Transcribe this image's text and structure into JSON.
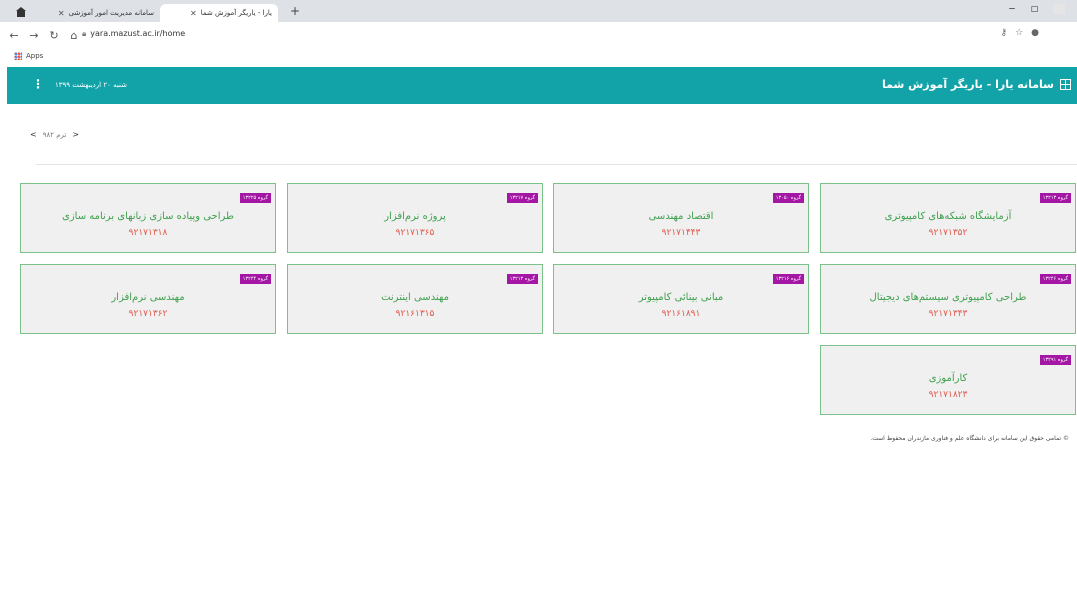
{
  "browser": {
    "tabs": [
      {
        "title": "سامانه مدیریت امور آموزشی"
      },
      {
        "title": "یارا - یاریگر آموزش شما"
      }
    ],
    "url": "yara.mazust.ac.ir/home",
    "bookmarks_apps": "Apps"
  },
  "header": {
    "brand": "سامانه یارا - یاریگر آموزش شما",
    "date": "شنبه ۲۰ اردیبهشت ۱۳۹۹"
  },
  "term": {
    "label": "ترم ۹۸۲"
  },
  "courses": [
    {
      "group": "گروه ۱۳۲۱۳",
      "title": "آزمایشگاه شبکه‌های کامپیوتری",
      "code": "۹۲۱۷۱۳۵۲"
    },
    {
      "group": "گروه ۱۳۰۵۰",
      "title": "اقتصاد مهندسی",
      "code": "۹۲۱۷۱۴۴۳"
    },
    {
      "group": "گروه ۱۳۲۱۷",
      "title": "پروژه نرم‌افزار",
      "code": "۹۲۱۷۱۳۶۵"
    },
    {
      "group": "گروه ۱۳۲۲۵",
      "title": "طراحی وپیاده سازی زبانهای برنامه سازی",
      "code": "۹۲۱۷۱۳۱۸"
    },
    {
      "group": "گروه ۱۳۲۴۶",
      "title": "طراحی کامپیوتری سیستم‌های دیجیتال",
      "code": "۹۲۱۷۱۳۴۳"
    },
    {
      "group": "گروه ۱۳۲۱۶",
      "title": "مبانی بینائی کامپیوتر",
      "code": "۹۲۱۶۱۸۹۱"
    },
    {
      "group": "گروه ۱۳۲۱۳",
      "title": "مهندسی اینترنت",
      "code": "۹۲۱۶۱۳۱۵"
    },
    {
      "group": "گروه ۱۳۲۴۴",
      "title": "مهندسی نرم‌افزار",
      "code": "۹۲۱۷۱۳۶۲"
    },
    {
      "group": "گروه ۱۳۲۹۱",
      "title": "کارآموزی",
      "code": "۹۲۱۷۱۸۲۳"
    }
  ],
  "footer": "© تمامی حقوق این سامانه برای دانشگاه علم و فناوری مازندران محفوظ است.",
  "colors": {
    "header_bg": "#12a3a8",
    "badge": "#a317a4",
    "title_green": "#3fa04d",
    "code_red": "#e05a4d",
    "card_border": "#7cc08a"
  },
  "icons": {
    "back": "arrow-left-icon",
    "forward": "arrow-right-icon",
    "reload": "reload-icon",
    "home": "home-icon",
    "menu": "kebab-menu-icon"
  }
}
